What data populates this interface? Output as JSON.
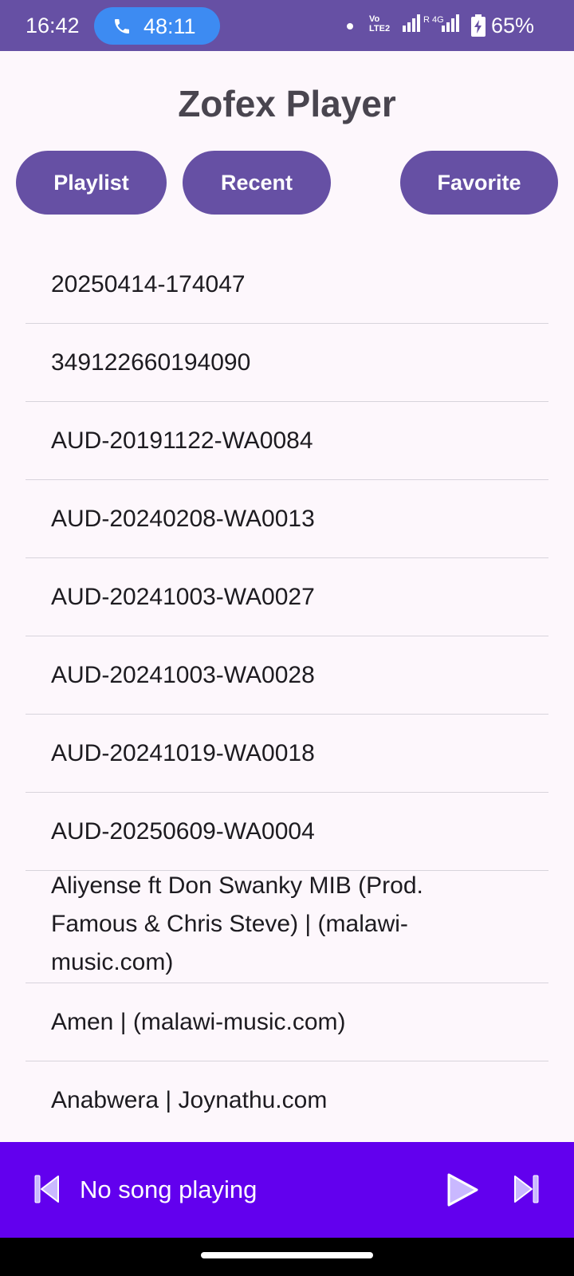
{
  "status_bar": {
    "time": "16:42",
    "call_timer": "48:11",
    "network_label": "Vo LTE2",
    "roaming_label": "R 4G",
    "battery_percent": "65%",
    "icons": [
      "phone-icon",
      "notification-dot-icon",
      "volte-icon",
      "signal-icon",
      "battery-charging-icon"
    ]
  },
  "app": {
    "title": "Zofex Player"
  },
  "tabs": [
    {
      "label": "Playlist"
    },
    {
      "label": "Recent"
    },
    {
      "label": "Favorite"
    }
  ],
  "songs": [
    {
      "title": "20250414-174047"
    },
    {
      "title": "349122660194090"
    },
    {
      "title": "AUD-20191122-WA0084"
    },
    {
      "title": "AUD-20240208-WA0013"
    },
    {
      "title": "AUD-20241003-WA0027"
    },
    {
      "title": "AUD-20241003-WA0028"
    },
    {
      "title": "AUD-20241019-WA0018"
    },
    {
      "title": "AUD-20250609-WA0004"
    },
    {
      "title": "Aliyense ft Don Swanky MIB (Prod. Famous & Chris Steve) | (malawi-music.com)"
    },
    {
      "title": "Amen | (malawi-music.com)"
    },
    {
      "title": "Anabwera | Joynathu.com"
    }
  ],
  "player": {
    "status": "No song playing",
    "icons": [
      "skip-previous-icon",
      "play-icon",
      "skip-next-icon"
    ]
  },
  "colors": {
    "status_bar": "#6650A4",
    "call_pill": "#3D8BF2",
    "tab_button": "#6650A4",
    "background": "#FDF7FC",
    "player_bar": "#6200EE",
    "player_icon": "#C9B8FF"
  }
}
